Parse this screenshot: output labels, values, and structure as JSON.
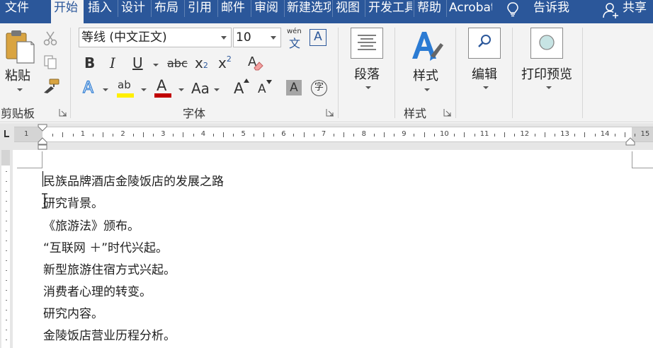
{
  "tabs": [
    {
      "label": "文件",
      "active": false
    },
    {
      "label": "开始",
      "active": true
    },
    {
      "label": "插入",
      "active": false
    },
    {
      "label": "设计",
      "active": false
    },
    {
      "label": "布局",
      "active": false
    },
    {
      "label": "引用",
      "active": false
    },
    {
      "label": "邮件",
      "active": false
    },
    {
      "label": "审阅",
      "active": false
    },
    {
      "label": "新建选项卡",
      "active": false
    },
    {
      "label": "视图",
      "active": false
    },
    {
      "label": "开发工具",
      "active": false
    },
    {
      "label": "帮助",
      "active": false
    },
    {
      "label": "Acrobat",
      "active": false
    }
  ],
  "tellme": {
    "label": "告诉我",
    "icon": "lightbulb-icon"
  },
  "share": {
    "label": "共享",
    "icon": "person-add-icon"
  },
  "clipboard": {
    "paste_label": "粘贴",
    "group_label": "剪贴板",
    "icons": [
      "clipboard-icon",
      "scissors-icon",
      "copy-icon",
      "format-painter-icon"
    ]
  },
  "font": {
    "font_name": "等线 (中文正文)",
    "font_size": "10",
    "phonetic_top": "wén",
    "phonetic_bottom": "文",
    "char_border": "A",
    "bold": "B",
    "italic": "I",
    "underline": "U",
    "strikethrough": "abc",
    "subscript": "x",
    "subscript_small": "2",
    "superscript": "x",
    "superscript_small": "2",
    "clear_format": "A",
    "text_effects": "A",
    "highlight": "ab",
    "font_color": "A",
    "change_case": "Aa",
    "grow_font": "A",
    "shrink_font": "A",
    "char_shading": "A",
    "enclose_char": "字",
    "group_label": "字体",
    "highlight_color": "#ffef00",
    "font_color_bar": "#c00000"
  },
  "paragraph": {
    "label": "段落"
  },
  "styles": {
    "label": "样式",
    "group_label": "样式"
  },
  "editing": {
    "label": "编辑"
  },
  "print_preview": {
    "label": "打印预览"
  },
  "ruler": {
    "numbers": [
      "1",
      "2",
      "3",
      "4",
      "5",
      "6",
      "7",
      "8",
      "9",
      "10",
      "11",
      "12",
      "13",
      "14",
      "15"
    ],
    "left_marker": "1"
  },
  "document": {
    "paragraphs": [
      "民族品牌酒店金陵饭店的发展之路",
      "研究背景。",
      "《旅游法》颁布。",
      "“互联网 ＋”时代兴起。",
      "新型旅游住宿方式兴起。",
      "消费者心理的转变。",
      "研究内容。",
      "金陵饭店营业历程分析。"
    ]
  },
  "colors": {
    "tab_bar": "#2b579a",
    "ribbon_bg": "#f3f3f3",
    "styles_accent": "#2b7bd3"
  }
}
